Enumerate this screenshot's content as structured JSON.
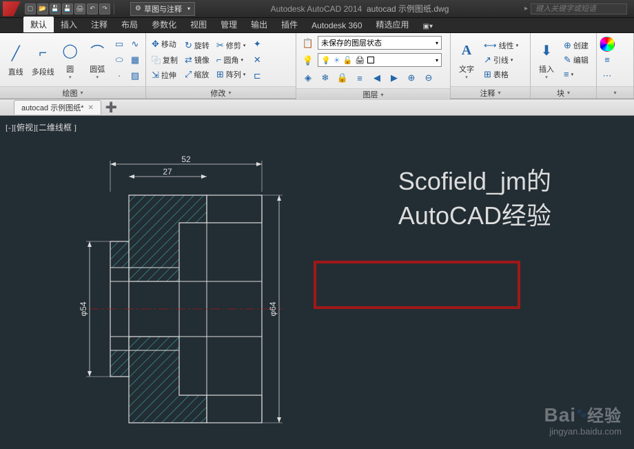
{
  "titlebar": {
    "workspace": "草图与注释",
    "app": "Autodesk AutoCAD 2014",
    "file": "autocad 示例图纸.dwg",
    "search_placeholder": "键入关键字或短语"
  },
  "menutabs": [
    "默认",
    "插入",
    "注释",
    "布局",
    "参数化",
    "视图",
    "管理",
    "输出",
    "插件",
    "Autodesk 360",
    "精选应用"
  ],
  "menutab_active": 0,
  "ribbon": {
    "draw": {
      "title": "绘图",
      "line": "直线",
      "polyline": "多段线",
      "circle": "圆",
      "arc": "圆弧"
    },
    "modify": {
      "title": "修改",
      "move": "移动",
      "copy": "复制",
      "stretch": "拉伸",
      "rotate": "旋转",
      "mirror": "镜像",
      "scale": "缩放",
      "trim": "修剪",
      "fillet": "圆角",
      "array": "阵列"
    },
    "layers": {
      "title": "图层",
      "state": "未保存的图层状态"
    },
    "annotation": {
      "title": "注释",
      "text": "文字",
      "linetype": "线性",
      "leader": "引线",
      "table": "表格"
    },
    "block": {
      "title": "块",
      "insert": "插入",
      "create": "创建",
      "edit": "编辑"
    }
  },
  "filetab": {
    "name": "autocad 示例图纸*"
  },
  "canvas": {
    "view_label": "[-][俯视][二维线框 ]",
    "dims": {
      "top_outer": "52",
      "top_inner": "27",
      "left": "φ54",
      "right": "φ64"
    },
    "annotation_line1": "Scofield_jm的",
    "annotation_line2": "AutoCAD经验"
  },
  "watermark": {
    "brand": "Bai",
    "brand2": "经验",
    "url": "jingyan.baidu.com"
  }
}
